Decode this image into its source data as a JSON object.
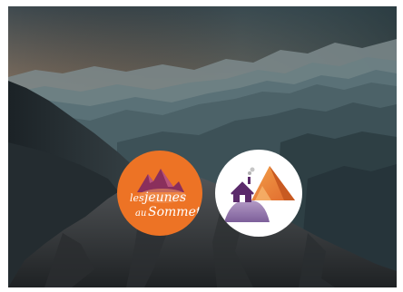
{
  "colors": {
    "sky_top": "#4a5257",
    "sky_glow": "#c9855a",
    "mist": "#7d8f95",
    "teal_far": "#5f7d84",
    "ridge_dark": "#20292d",
    "rock": "#3e4145",
    "logo_orange": "#ed7325",
    "logo_white": "#ffffff",
    "logo_purple": "#5b2a6b",
    "logo_lavender": "#9b7fb3"
  },
  "logos": {
    "left": {
      "line1": "les",
      "line2": "jeunes",
      "line3": "au",
      "line4": "Sommet",
      "icon": "mountain-peaks-icon"
    },
    "right": {
      "icon": "mountain-chalet-icon"
    }
  }
}
